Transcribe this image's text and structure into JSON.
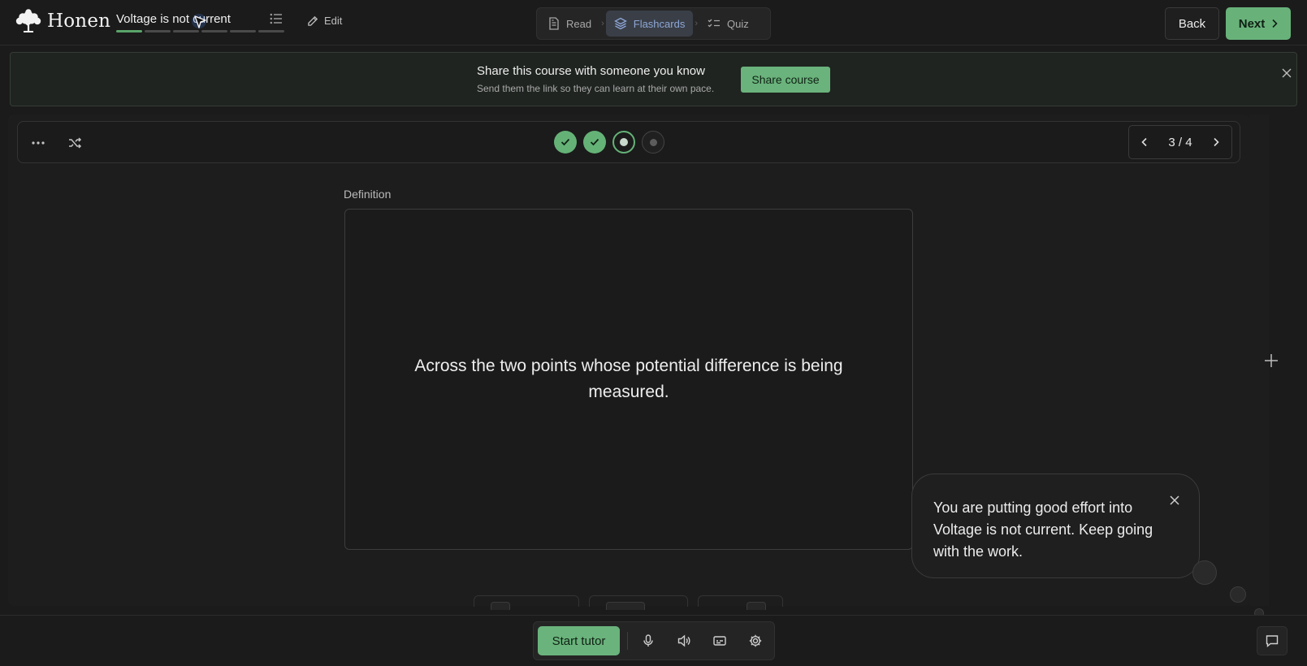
{
  "app": {
    "name": "Honen"
  },
  "header": {
    "course_title": "Voltage is not current",
    "progress_segments": [
      true,
      false,
      false,
      false,
      false,
      false
    ],
    "edit_label": "Edit",
    "steps": [
      {
        "label": "Read",
        "icon": "document-icon",
        "active": false
      },
      {
        "label": "Flashcards",
        "icon": "layers-icon",
        "active": true
      },
      {
        "label": "Quiz",
        "icon": "checklist-icon",
        "active": false
      }
    ],
    "back_label": "Back",
    "next_label": "Next"
  },
  "banner": {
    "title": "Share this course with someone you know",
    "subtitle": "Send them the link so they can learn at their own pace.",
    "share_label": "Share course"
  },
  "flashcards": {
    "card_statuses": [
      "done",
      "done",
      "current",
      "todo"
    ],
    "pager": {
      "current": 3,
      "total": 4,
      "text": "3 / 4"
    },
    "side_label": "Definition",
    "card_text": "Across the two points whose potential difference is being measured."
  },
  "toast": {
    "message": "You are putting good effort into Voltage is not current. Keep going with the work."
  },
  "bottombar": {
    "start_tutor_label": "Start tutor"
  },
  "colors": {
    "accent_green": "#6ab37c",
    "active_step_text": "#8ea6d6",
    "background": "#1b1b1b"
  }
}
